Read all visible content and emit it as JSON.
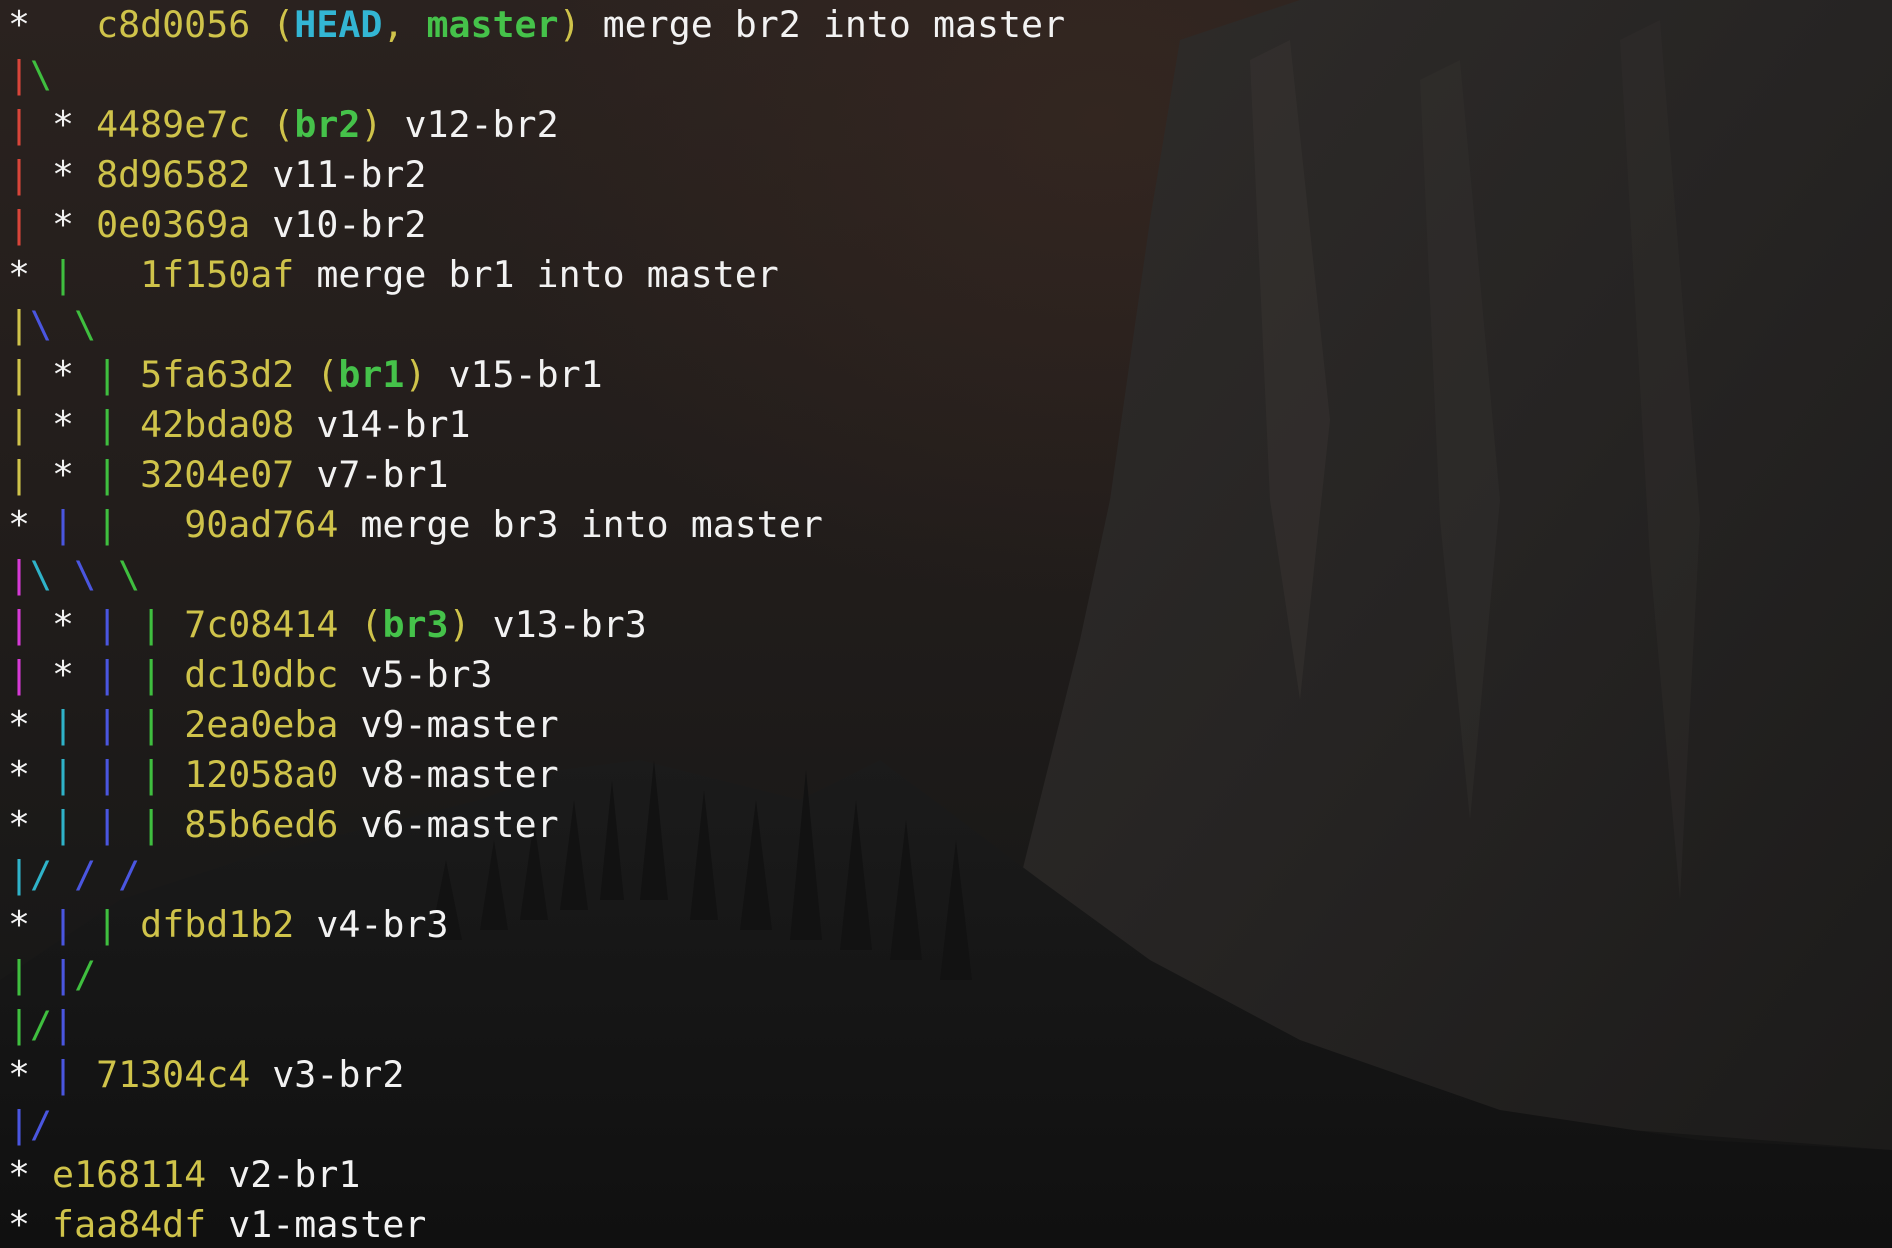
{
  "terminal": {
    "lines": [
      [
        {
          "t": "*   ",
          "c": "white"
        },
        {
          "t": "c8d0056",
          "c": "hash"
        },
        {
          "t": " (",
          "c": "yellow"
        },
        {
          "t": "HEAD",
          "c": "bcyan"
        },
        {
          "t": ", ",
          "c": "yellow"
        },
        {
          "t": "master",
          "c": "bgreen"
        },
        {
          "t": ")",
          "c": "yellow"
        },
        {
          "t": " merge br2 into master",
          "c": "white"
        }
      ],
      [
        {
          "t": "|",
          "c": "red"
        },
        {
          "t": "\\",
          "c": "green"
        }
      ],
      [
        {
          "t": "|",
          "c": "red"
        },
        {
          "t": " * ",
          "c": "white"
        },
        {
          "t": "4489e7c",
          "c": "hash"
        },
        {
          "t": " (",
          "c": "yellow"
        },
        {
          "t": "br2",
          "c": "bgreen"
        },
        {
          "t": ")",
          "c": "yellow"
        },
        {
          "t": " v12-br2",
          "c": "white"
        }
      ],
      [
        {
          "t": "|",
          "c": "red"
        },
        {
          "t": " * ",
          "c": "white"
        },
        {
          "t": "8d96582",
          "c": "hash"
        },
        {
          "t": " v11-br2",
          "c": "white"
        }
      ],
      [
        {
          "t": "|",
          "c": "red"
        },
        {
          "t": " * ",
          "c": "white"
        },
        {
          "t": "0e0369a",
          "c": "hash"
        },
        {
          "t": " v10-br2",
          "c": "white"
        }
      ],
      [
        {
          "t": "* ",
          "c": "white"
        },
        {
          "t": "|",
          "c": "green"
        },
        {
          "t": "   ",
          "c": "white"
        },
        {
          "t": "1f150af",
          "c": "hash"
        },
        {
          "t": " merge br1 into master",
          "c": "white"
        }
      ],
      [
        {
          "t": "|",
          "c": "yellow"
        },
        {
          "t": "\\",
          "c": "blue"
        },
        {
          "t": " ",
          "c": "white"
        },
        {
          "t": "\\",
          "c": "green"
        }
      ],
      [
        {
          "t": "|",
          "c": "yellow"
        },
        {
          "t": " * ",
          "c": "white"
        },
        {
          "t": "|",
          "c": "green"
        },
        {
          "t": " ",
          "c": "white"
        },
        {
          "t": "5fa63d2",
          "c": "hash"
        },
        {
          "t": " (",
          "c": "yellow"
        },
        {
          "t": "br1",
          "c": "bgreen"
        },
        {
          "t": ")",
          "c": "yellow"
        },
        {
          "t": " v15-br1",
          "c": "white"
        }
      ],
      [
        {
          "t": "|",
          "c": "yellow"
        },
        {
          "t": " * ",
          "c": "white"
        },
        {
          "t": "|",
          "c": "green"
        },
        {
          "t": " ",
          "c": "white"
        },
        {
          "t": "42bda08",
          "c": "hash"
        },
        {
          "t": " v14-br1",
          "c": "white"
        }
      ],
      [
        {
          "t": "|",
          "c": "yellow"
        },
        {
          "t": " * ",
          "c": "white"
        },
        {
          "t": "|",
          "c": "green"
        },
        {
          "t": " ",
          "c": "white"
        },
        {
          "t": "3204e07",
          "c": "hash"
        },
        {
          "t": " v7-br1",
          "c": "white"
        }
      ],
      [
        {
          "t": "* ",
          "c": "white"
        },
        {
          "t": "|",
          "c": "blue"
        },
        {
          "t": " ",
          "c": "white"
        },
        {
          "t": "|",
          "c": "green"
        },
        {
          "t": "   ",
          "c": "white"
        },
        {
          "t": "90ad764",
          "c": "hash"
        },
        {
          "t": " merge br3 into master",
          "c": "white"
        }
      ],
      [
        {
          "t": "|",
          "c": "magenta"
        },
        {
          "t": "\\",
          "c": "cyan"
        },
        {
          "t": " ",
          "c": "white"
        },
        {
          "t": "\\",
          "c": "blue"
        },
        {
          "t": " ",
          "c": "white"
        },
        {
          "t": "\\",
          "c": "green"
        }
      ],
      [
        {
          "t": "|",
          "c": "magenta"
        },
        {
          "t": " * ",
          "c": "white"
        },
        {
          "t": "|",
          "c": "blue"
        },
        {
          "t": " ",
          "c": "white"
        },
        {
          "t": "|",
          "c": "green"
        },
        {
          "t": " ",
          "c": "white"
        },
        {
          "t": "7c08414",
          "c": "hash"
        },
        {
          "t": " (",
          "c": "yellow"
        },
        {
          "t": "br3",
          "c": "bgreen"
        },
        {
          "t": ")",
          "c": "yellow"
        },
        {
          "t": " v13-br3",
          "c": "white"
        }
      ],
      [
        {
          "t": "|",
          "c": "magenta"
        },
        {
          "t": " * ",
          "c": "white"
        },
        {
          "t": "|",
          "c": "blue"
        },
        {
          "t": " ",
          "c": "white"
        },
        {
          "t": "|",
          "c": "green"
        },
        {
          "t": " ",
          "c": "white"
        },
        {
          "t": "dc10dbc",
          "c": "hash"
        },
        {
          "t": " v5-br3",
          "c": "white"
        }
      ],
      [
        {
          "t": "* ",
          "c": "white"
        },
        {
          "t": "|",
          "c": "cyan"
        },
        {
          "t": " ",
          "c": "white"
        },
        {
          "t": "|",
          "c": "blue"
        },
        {
          "t": " ",
          "c": "white"
        },
        {
          "t": "|",
          "c": "green"
        },
        {
          "t": " ",
          "c": "white"
        },
        {
          "t": "2ea0eba",
          "c": "hash"
        },
        {
          "t": " v9-master",
          "c": "white"
        }
      ],
      [
        {
          "t": "* ",
          "c": "white"
        },
        {
          "t": "|",
          "c": "cyan"
        },
        {
          "t": " ",
          "c": "white"
        },
        {
          "t": "|",
          "c": "blue"
        },
        {
          "t": " ",
          "c": "white"
        },
        {
          "t": "|",
          "c": "green"
        },
        {
          "t": " ",
          "c": "white"
        },
        {
          "t": "12058a0",
          "c": "hash"
        },
        {
          "t": " v8-master",
          "c": "white"
        }
      ],
      [
        {
          "t": "* ",
          "c": "white"
        },
        {
          "t": "|",
          "c": "cyan"
        },
        {
          "t": " ",
          "c": "white"
        },
        {
          "t": "|",
          "c": "blue"
        },
        {
          "t": " ",
          "c": "white"
        },
        {
          "t": "|",
          "c": "green"
        },
        {
          "t": " ",
          "c": "white"
        },
        {
          "t": "85b6ed6",
          "c": "hash"
        },
        {
          "t": " v6-master",
          "c": "white"
        }
      ],
      [
        {
          "t": "|",
          "c": "cyan"
        },
        {
          "t": "/",
          "c": "cyan"
        },
        {
          "t": " ",
          "c": "white"
        },
        {
          "t": "/",
          "c": "blue"
        },
        {
          "t": " ",
          "c": "white"
        },
        {
          "t": "/",
          "c": "blue"
        }
      ],
      [
        {
          "t": "* ",
          "c": "white"
        },
        {
          "t": "|",
          "c": "blue"
        },
        {
          "t": " ",
          "c": "white"
        },
        {
          "t": "|",
          "c": "green"
        },
        {
          "t": " ",
          "c": "white"
        },
        {
          "t": "dfbd1b2",
          "c": "hash"
        },
        {
          "t": " v4-br3",
          "c": "white"
        }
      ],
      [
        {
          "t": "|",
          "c": "green"
        },
        {
          "t": " ",
          "c": "white"
        },
        {
          "t": "|",
          "c": "blue"
        },
        {
          "t": "/",
          "c": "green"
        }
      ],
      [
        {
          "t": "|",
          "c": "green"
        },
        {
          "t": "/",
          "c": "green"
        },
        {
          "t": "|",
          "c": "blue"
        }
      ],
      [
        {
          "t": "* ",
          "c": "white"
        },
        {
          "t": "|",
          "c": "blue"
        },
        {
          "t": " ",
          "c": "white"
        },
        {
          "t": "71304c4",
          "c": "hash"
        },
        {
          "t": " v3-br2",
          "c": "white"
        }
      ],
      [
        {
          "t": "|",
          "c": "blue"
        },
        {
          "t": "/",
          "c": "blue"
        }
      ],
      [
        {
          "t": "* ",
          "c": "white"
        },
        {
          "t": "e168114",
          "c": "hash"
        },
        {
          "t": " v2-br1",
          "c": "white"
        }
      ],
      [
        {
          "t": "* ",
          "c": "white"
        },
        {
          "t": "faa84df",
          "c": "hash"
        },
        {
          "t": " v1-master",
          "c": "white"
        }
      ]
    ]
  }
}
